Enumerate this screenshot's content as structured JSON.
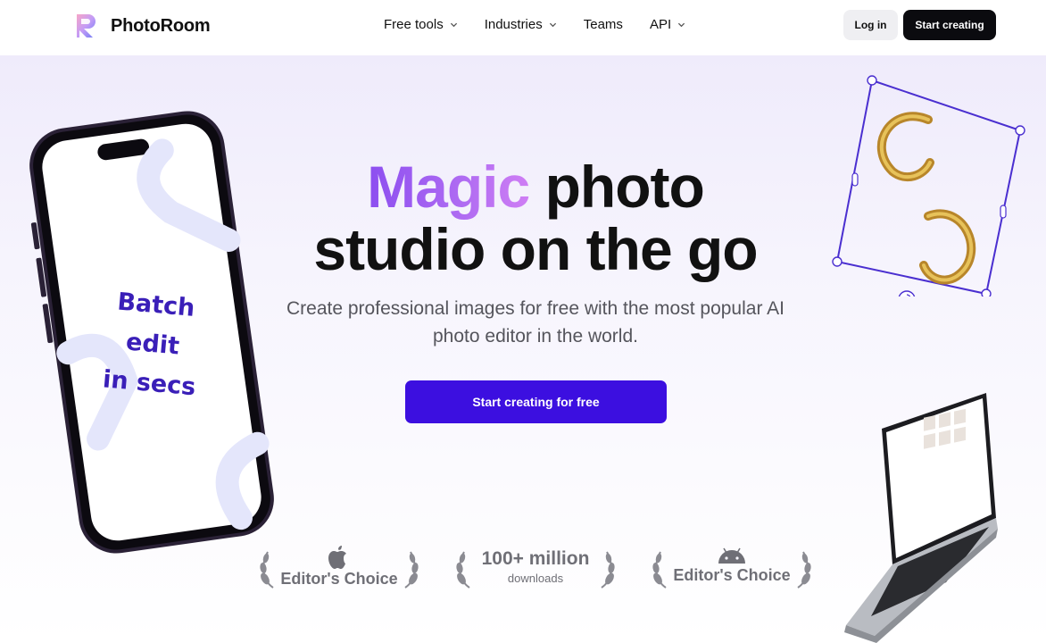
{
  "brand": {
    "name": "PhotoRoom"
  },
  "nav": {
    "links": [
      {
        "label": "Free tools",
        "dropdown": true
      },
      {
        "label": "Industries",
        "dropdown": true
      },
      {
        "label": "Teams",
        "dropdown": false
      },
      {
        "label": "API",
        "dropdown": true
      }
    ],
    "login_label": "Log in",
    "start_label": "Start creating"
  },
  "hero": {
    "headline_accent": "Magic",
    "headline_rest_line1": "photo",
    "headline_line2": "studio on the go",
    "subtitle": "Create professional images for free with the most popular AI photo editor in the world.",
    "cta_label": "Start creating for free",
    "phone_text_line1": "Batch edit",
    "phone_text_line2": "in secs"
  },
  "awards": [
    {
      "icon": "apple-icon",
      "title": "Editor's Choice",
      "sub": ""
    },
    {
      "icon": "",
      "title": "100+ million",
      "sub": "downloads"
    },
    {
      "icon": "android-icon",
      "title": "Editor's Choice",
      "sub": ""
    }
  ],
  "colors": {
    "accent": "#3c0fe0",
    "magic_gradient_start": "#8c4ef0",
    "magic_gradient_end": "#cf7ef4",
    "dark": "#0b0b0f"
  }
}
